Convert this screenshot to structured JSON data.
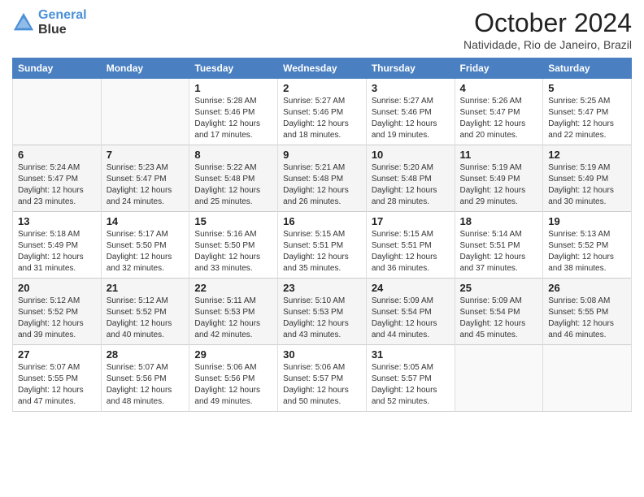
{
  "header": {
    "logo_line1": "General",
    "logo_line2": "Blue",
    "month": "October 2024",
    "location": "Natividade, Rio de Janeiro, Brazil"
  },
  "weekdays": [
    "Sunday",
    "Monday",
    "Tuesday",
    "Wednesday",
    "Thursday",
    "Friday",
    "Saturday"
  ],
  "weeks": [
    [
      {
        "day": "",
        "info": ""
      },
      {
        "day": "",
        "info": ""
      },
      {
        "day": "1",
        "info": "Sunrise: 5:28 AM\nSunset: 5:46 PM\nDaylight: 12 hours and 17 minutes."
      },
      {
        "day": "2",
        "info": "Sunrise: 5:27 AM\nSunset: 5:46 PM\nDaylight: 12 hours and 18 minutes."
      },
      {
        "day": "3",
        "info": "Sunrise: 5:27 AM\nSunset: 5:46 PM\nDaylight: 12 hours and 19 minutes."
      },
      {
        "day": "4",
        "info": "Sunrise: 5:26 AM\nSunset: 5:47 PM\nDaylight: 12 hours and 20 minutes."
      },
      {
        "day": "5",
        "info": "Sunrise: 5:25 AM\nSunset: 5:47 PM\nDaylight: 12 hours and 22 minutes."
      }
    ],
    [
      {
        "day": "6",
        "info": "Sunrise: 5:24 AM\nSunset: 5:47 PM\nDaylight: 12 hours and 23 minutes."
      },
      {
        "day": "7",
        "info": "Sunrise: 5:23 AM\nSunset: 5:47 PM\nDaylight: 12 hours and 24 minutes."
      },
      {
        "day": "8",
        "info": "Sunrise: 5:22 AM\nSunset: 5:48 PM\nDaylight: 12 hours and 25 minutes."
      },
      {
        "day": "9",
        "info": "Sunrise: 5:21 AM\nSunset: 5:48 PM\nDaylight: 12 hours and 26 minutes."
      },
      {
        "day": "10",
        "info": "Sunrise: 5:20 AM\nSunset: 5:48 PM\nDaylight: 12 hours and 28 minutes."
      },
      {
        "day": "11",
        "info": "Sunrise: 5:19 AM\nSunset: 5:49 PM\nDaylight: 12 hours and 29 minutes."
      },
      {
        "day": "12",
        "info": "Sunrise: 5:19 AM\nSunset: 5:49 PM\nDaylight: 12 hours and 30 minutes."
      }
    ],
    [
      {
        "day": "13",
        "info": "Sunrise: 5:18 AM\nSunset: 5:49 PM\nDaylight: 12 hours and 31 minutes."
      },
      {
        "day": "14",
        "info": "Sunrise: 5:17 AM\nSunset: 5:50 PM\nDaylight: 12 hours and 32 minutes."
      },
      {
        "day": "15",
        "info": "Sunrise: 5:16 AM\nSunset: 5:50 PM\nDaylight: 12 hours and 33 minutes."
      },
      {
        "day": "16",
        "info": "Sunrise: 5:15 AM\nSunset: 5:51 PM\nDaylight: 12 hours and 35 minutes."
      },
      {
        "day": "17",
        "info": "Sunrise: 5:15 AM\nSunset: 5:51 PM\nDaylight: 12 hours and 36 minutes."
      },
      {
        "day": "18",
        "info": "Sunrise: 5:14 AM\nSunset: 5:51 PM\nDaylight: 12 hours and 37 minutes."
      },
      {
        "day": "19",
        "info": "Sunrise: 5:13 AM\nSunset: 5:52 PM\nDaylight: 12 hours and 38 minutes."
      }
    ],
    [
      {
        "day": "20",
        "info": "Sunrise: 5:12 AM\nSunset: 5:52 PM\nDaylight: 12 hours and 39 minutes."
      },
      {
        "day": "21",
        "info": "Sunrise: 5:12 AM\nSunset: 5:52 PM\nDaylight: 12 hours and 40 minutes."
      },
      {
        "day": "22",
        "info": "Sunrise: 5:11 AM\nSunset: 5:53 PM\nDaylight: 12 hours and 42 minutes."
      },
      {
        "day": "23",
        "info": "Sunrise: 5:10 AM\nSunset: 5:53 PM\nDaylight: 12 hours and 43 minutes."
      },
      {
        "day": "24",
        "info": "Sunrise: 5:09 AM\nSunset: 5:54 PM\nDaylight: 12 hours and 44 minutes."
      },
      {
        "day": "25",
        "info": "Sunrise: 5:09 AM\nSunset: 5:54 PM\nDaylight: 12 hours and 45 minutes."
      },
      {
        "day": "26",
        "info": "Sunrise: 5:08 AM\nSunset: 5:55 PM\nDaylight: 12 hours and 46 minutes."
      }
    ],
    [
      {
        "day": "27",
        "info": "Sunrise: 5:07 AM\nSunset: 5:55 PM\nDaylight: 12 hours and 47 minutes."
      },
      {
        "day": "28",
        "info": "Sunrise: 5:07 AM\nSunset: 5:56 PM\nDaylight: 12 hours and 48 minutes."
      },
      {
        "day": "29",
        "info": "Sunrise: 5:06 AM\nSunset: 5:56 PM\nDaylight: 12 hours and 49 minutes."
      },
      {
        "day": "30",
        "info": "Sunrise: 5:06 AM\nSunset: 5:57 PM\nDaylight: 12 hours and 50 minutes."
      },
      {
        "day": "31",
        "info": "Sunrise: 5:05 AM\nSunset: 5:57 PM\nDaylight: 12 hours and 52 minutes."
      },
      {
        "day": "",
        "info": ""
      },
      {
        "day": "",
        "info": ""
      }
    ]
  ]
}
